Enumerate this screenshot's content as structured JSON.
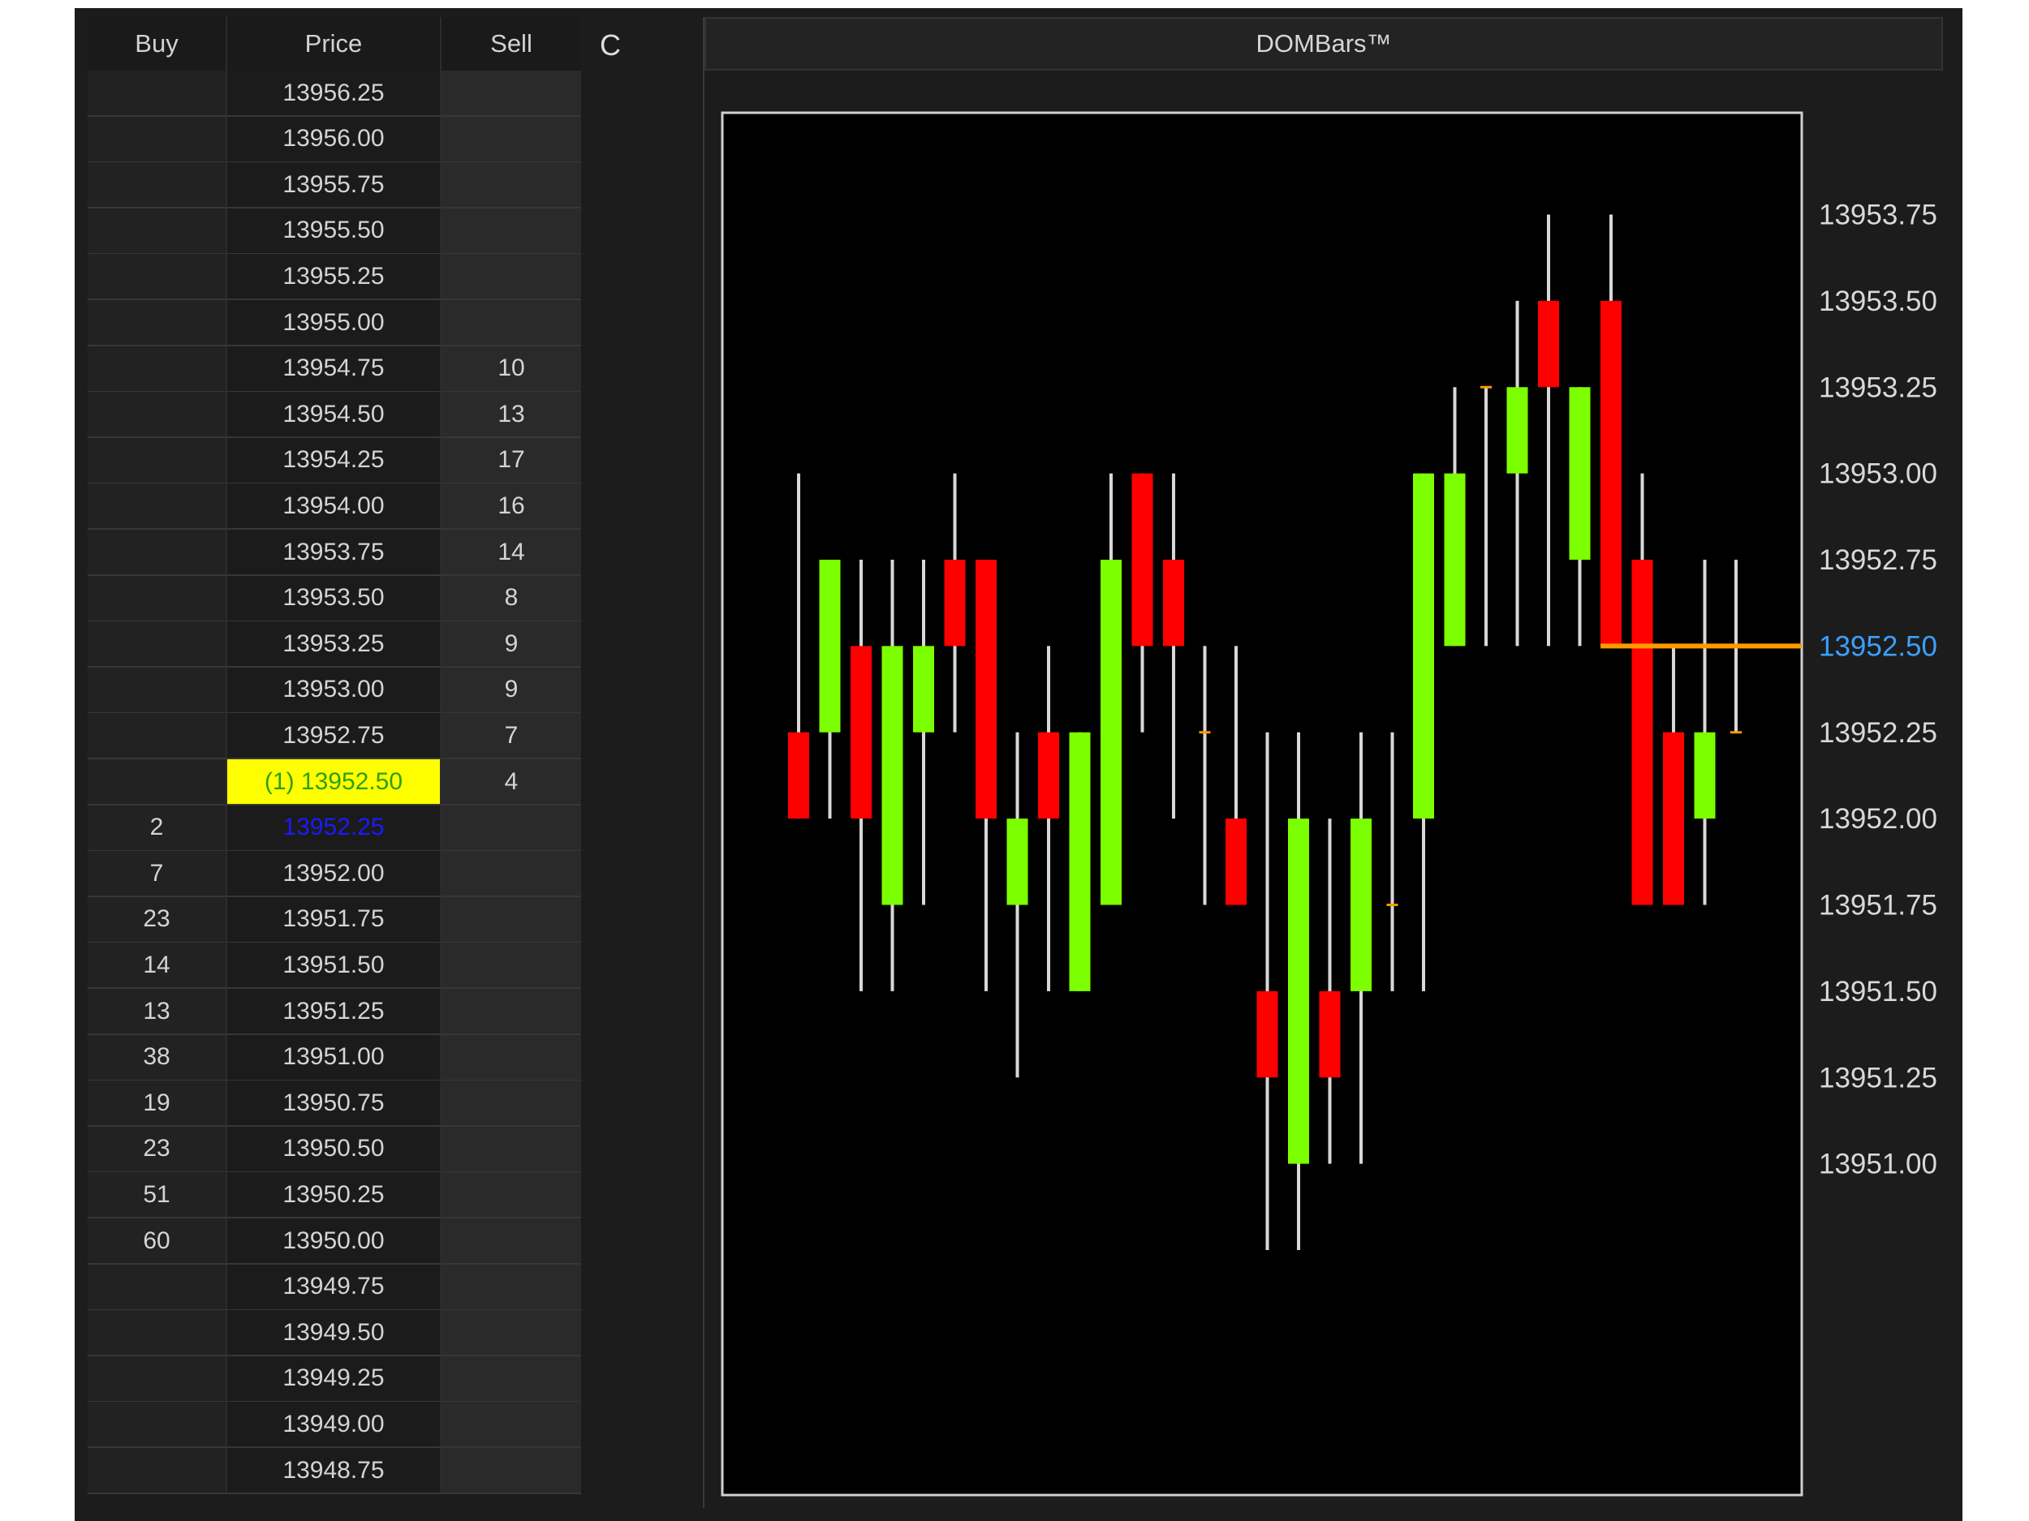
{
  "ladder": {
    "headers": {
      "buy": "Buy",
      "price": "Price",
      "sell": "Sell"
    },
    "clear_label": "C",
    "current_index": 15,
    "bid_index": 16,
    "rows": [
      {
        "buy": "",
        "price": "13956.25",
        "sell": ""
      },
      {
        "buy": "",
        "price": "13956.00",
        "sell": ""
      },
      {
        "buy": "",
        "price": "13955.75",
        "sell": ""
      },
      {
        "buy": "",
        "price": "13955.50",
        "sell": ""
      },
      {
        "buy": "",
        "price": "13955.25",
        "sell": ""
      },
      {
        "buy": "",
        "price": "13955.00",
        "sell": ""
      },
      {
        "buy": "",
        "price": "13954.75",
        "sell": "10"
      },
      {
        "buy": "",
        "price": "13954.50",
        "sell": "13"
      },
      {
        "buy": "",
        "price": "13954.25",
        "sell": "17"
      },
      {
        "buy": "",
        "price": "13954.00",
        "sell": "16"
      },
      {
        "buy": "",
        "price": "13953.75",
        "sell": "14"
      },
      {
        "buy": "",
        "price": "13953.50",
        "sell": "8"
      },
      {
        "buy": "",
        "price": "13953.25",
        "sell": "9"
      },
      {
        "buy": "",
        "price": "13953.00",
        "sell": "9"
      },
      {
        "buy": "",
        "price": "13952.75",
        "sell": "7"
      },
      {
        "buy": "",
        "price": "(1) 13952.50",
        "sell": "4"
      },
      {
        "buy": "2",
        "price": "13952.25",
        "sell": ""
      },
      {
        "buy": "7",
        "price": "13952.00",
        "sell": ""
      },
      {
        "buy": "23",
        "price": "13951.75",
        "sell": ""
      },
      {
        "buy": "14",
        "price": "13951.50",
        "sell": ""
      },
      {
        "buy": "13",
        "price": "13951.25",
        "sell": ""
      },
      {
        "buy": "38",
        "price": "13951.00",
        "sell": ""
      },
      {
        "buy": "19",
        "price": "13950.75",
        "sell": ""
      },
      {
        "buy": "23",
        "price": "13950.50",
        "sell": ""
      },
      {
        "buy": "51",
        "price": "13950.25",
        "sell": ""
      },
      {
        "buy": "60",
        "price": "13950.00",
        "sell": ""
      },
      {
        "buy": "",
        "price": "13949.75",
        "sell": ""
      },
      {
        "buy": "",
        "price": "13949.50",
        "sell": ""
      },
      {
        "buy": "",
        "price": "13949.25",
        "sell": ""
      },
      {
        "buy": "",
        "price": "13949.00",
        "sell": ""
      },
      {
        "buy": "",
        "price": "13948.75",
        "sell": ""
      }
    ]
  },
  "colors": {
    "up": "#7cff00",
    "down": "#ff0000",
    "wick": "#d8d8d8",
    "last_price_line": "#ff9900",
    "current_price_label": "#3aa0ff",
    "plot_background": "#000000"
  },
  "chart_data": {
    "type": "candlestick",
    "title": "DOMBars™",
    "y_ticks": [
      "13953.75",
      "13953.50",
      "13953.25",
      "13953.00",
      "13952.75",
      "13952.50",
      "13952.25",
      "13952.00",
      "13951.75",
      "13951.50",
      "13951.25",
      "13951.00"
    ],
    "current_price": "13952.50",
    "ylim": [
      13948.75,
      13954.0
    ],
    "candles": [
      {
        "open": 13952.25,
        "high": 13953.0,
        "low": 13952.0,
        "close": 13952.0
      },
      {
        "open": 13952.25,
        "high": 13952.75,
        "low": 13952.0,
        "close": 13952.75
      },
      {
        "open": 13952.5,
        "high": 13952.75,
        "low": 13951.5,
        "close": 13952.0
      },
      {
        "open": 13951.75,
        "high": 13952.75,
        "low": 13951.5,
        "close": 13952.5
      },
      {
        "open": 13952.25,
        "high": 13952.75,
        "low": 13951.75,
        "close": 13952.5
      },
      {
        "open": 13952.75,
        "high": 13953.0,
        "low": 13952.25,
        "close": 13952.5
      },
      {
        "open": 13952.75,
        "high": 13952.75,
        "low": 13951.5,
        "close": 13952.0
      },
      {
        "open": 13951.75,
        "high": 13952.25,
        "low": 13951.25,
        "close": 13952.0
      },
      {
        "open": 13952.25,
        "high": 13952.5,
        "low": 13951.5,
        "close": 13952.0
      },
      {
        "open": 13951.5,
        "high": 13952.25,
        "low": 13951.5,
        "close": 13952.25
      },
      {
        "open": 13951.75,
        "high": 13953.0,
        "low": 13951.75,
        "close": 13952.75
      },
      {
        "open": 13953.0,
        "high": 13953.0,
        "low": 13952.25,
        "close": 13952.5
      },
      {
        "open": 13952.75,
        "high": 13953.0,
        "low": 13952.0,
        "close": 13952.5
      },
      {
        "open": 13952.25,
        "high": 13952.5,
        "low": 13951.75,
        "close": 13952.25
      },
      {
        "open": 13952.0,
        "high": 13952.5,
        "low": 13951.75,
        "close": 13951.75
      },
      {
        "open": 13951.5,
        "high": 13952.25,
        "low": 13950.75,
        "close": 13951.25
      },
      {
        "open": 13951.0,
        "high": 13952.25,
        "low": 13950.75,
        "close": 13952.0
      },
      {
        "open": 13951.5,
        "high": 13952.0,
        "low": 13951.0,
        "close": 13951.25
      },
      {
        "open": 13951.5,
        "high": 13952.25,
        "low": 13951.0,
        "close": 13952.0
      },
      {
        "open": 13951.75,
        "high": 13952.25,
        "low": 13951.5,
        "close": 13951.75
      },
      {
        "open": 13952.0,
        "high": 13953.0,
        "low": 13951.5,
        "close": 13953.0
      },
      {
        "open": 13952.5,
        "high": 13953.25,
        "low": 13952.5,
        "close": 13953.0
      },
      {
        "open": 13953.25,
        "high": 13953.25,
        "low": 13952.5,
        "close": 13953.25
      },
      {
        "open": 13953.0,
        "high": 13953.5,
        "low": 13952.5,
        "close": 13953.25
      },
      {
        "open": 13953.5,
        "high": 13953.75,
        "low": 13952.5,
        "close": 13953.25
      },
      {
        "open": 13952.75,
        "high": 13953.25,
        "low": 13952.5,
        "close": 13953.25
      },
      {
        "open": 13953.5,
        "high": 13953.75,
        "low": 13952.5,
        "close": 13952.5
      },
      {
        "open": 13952.75,
        "high": 13953.0,
        "low": 13951.75,
        "close": 13951.75
      },
      {
        "open": 13952.25,
        "high": 13952.5,
        "low": 13951.75,
        "close": 13951.75
      },
      {
        "open": 13952.0,
        "high": 13952.75,
        "low": 13951.75,
        "close": 13952.25
      },
      {
        "open": 13952.25,
        "high": 13952.75,
        "low": 13952.25,
        "close": 13952.25
      }
    ]
  }
}
